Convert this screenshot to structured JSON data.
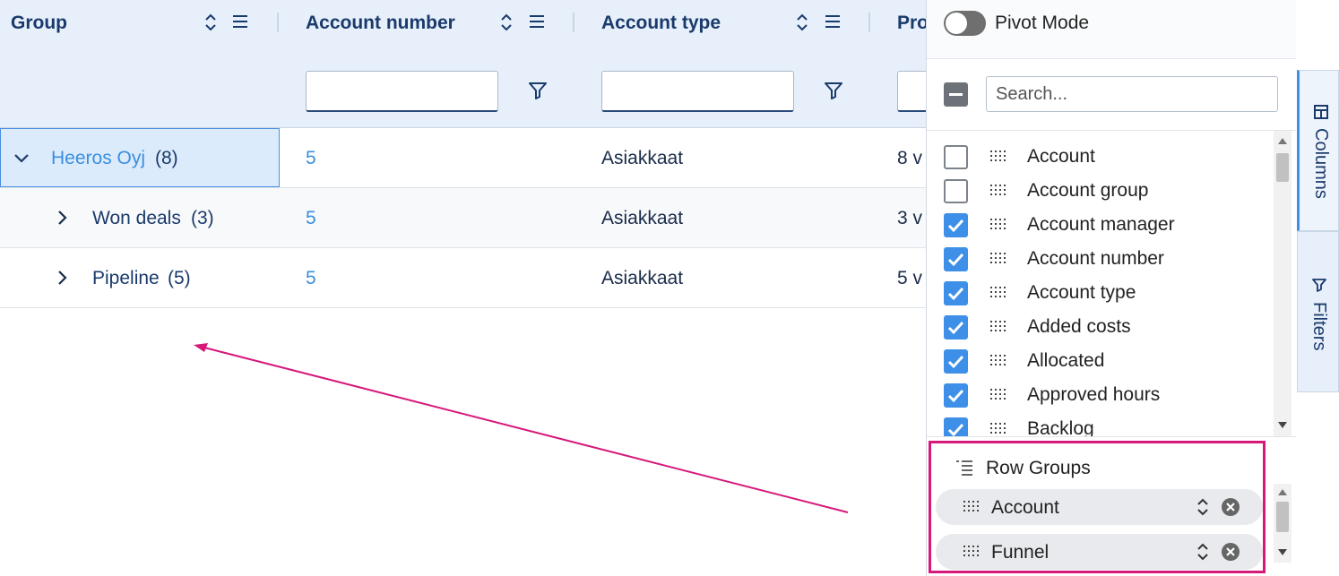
{
  "grid": {
    "columns": [
      {
        "title": "Group"
      },
      {
        "title": "Account number"
      },
      {
        "title": "Account type"
      },
      {
        "title": "Pro"
      }
    ],
    "rows": [
      {
        "group": "Heeros Oyj",
        "count": "(8)",
        "account_number": "5",
        "account_type": "Asiakkaat",
        "pro": "8 v"
      },
      {
        "group": "Won deals",
        "count": "(3)",
        "account_number": "5",
        "account_type": "Asiakkaat",
        "pro": "3 v"
      },
      {
        "group": "Pipeline",
        "count": "(5)",
        "account_number": "5",
        "account_type": "Asiakkaat",
        "pro": "5 v"
      }
    ]
  },
  "panel": {
    "pivot_label": "Pivot Mode",
    "pivot_on": false,
    "search_placeholder": "Search...",
    "columns": [
      {
        "label": "Account",
        "checked": false
      },
      {
        "label": "Account group",
        "checked": false
      },
      {
        "label": "Account manager",
        "checked": true
      },
      {
        "label": "Account number",
        "checked": true
      },
      {
        "label": "Account type",
        "checked": true
      },
      {
        "label": "Added costs",
        "checked": true
      },
      {
        "label": "Allocated",
        "checked": true
      },
      {
        "label": "Approved hours",
        "checked": true
      },
      {
        "label": "Backlog",
        "checked": true
      }
    ],
    "row_groups_title": "Row Groups",
    "row_groups": [
      {
        "label": "Account"
      },
      {
        "label": "Funnel"
      }
    ]
  },
  "sidebar": {
    "tabs": [
      {
        "label": "Columns"
      },
      {
        "label": "Filters"
      }
    ]
  },
  "colors": {
    "accent": "#3d8fe8",
    "annotation": "#d6187a",
    "header_bg": "#e6effa"
  }
}
